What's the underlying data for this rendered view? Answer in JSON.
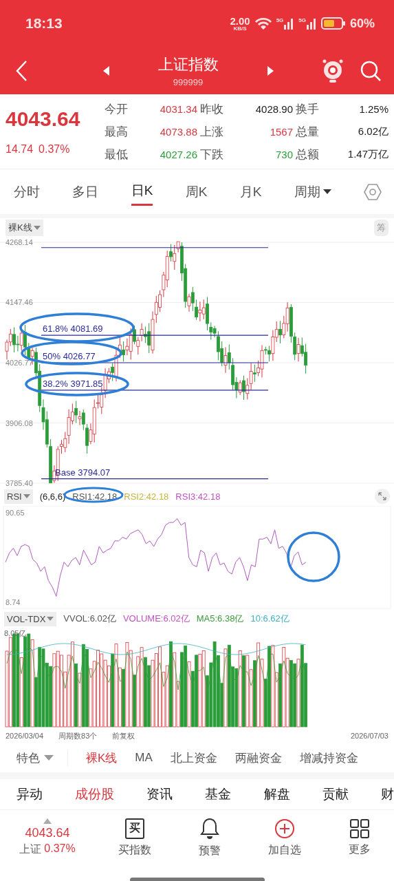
{
  "status_bar": {
    "time": "18:13",
    "net_speed": "2.00",
    "net_unit": "KB/S",
    "signals": [
      "5G",
      "5G"
    ],
    "battery": "60%"
  },
  "nav": {
    "title": "上证指数",
    "code": "999999"
  },
  "quote": {
    "price": "4043.64",
    "change": "14.74",
    "change_pct": "0.37%",
    "color": "#d9363e",
    "stats": [
      {
        "label": "今开",
        "value": "4031.34",
        "color": "#d9363e"
      },
      {
        "label": "昨收",
        "value": "4028.90",
        "color": "#222222"
      },
      {
        "label": "换手",
        "value": "1.25%",
        "color": "#222222"
      },
      {
        "label": "最高",
        "value": "4073.88",
        "color": "#d9363e"
      },
      {
        "label": "上涨",
        "value": "1567",
        "color": "#d9363e"
      },
      {
        "label": "总量",
        "value": "6.02亿",
        "color": "#222222"
      },
      {
        "label": "最低",
        "value": "4027.26",
        "color": "#2a9d3a"
      },
      {
        "label": "下跌",
        "value": "730",
        "color": "#2a9d3a"
      },
      {
        "label": "总额",
        "value": "1.47万亿",
        "color": "#222222"
      }
    ]
  },
  "period_tabs": [
    {
      "label": "分时",
      "selected": false,
      "dropdown": false
    },
    {
      "label": "多日",
      "selected": false,
      "dropdown": false
    },
    {
      "label": "日K",
      "selected": true,
      "dropdown": false
    },
    {
      "label": "周K",
      "selected": false,
      "dropdown": false
    },
    {
      "label": "月K",
      "selected": false,
      "dropdown": false
    },
    {
      "label": "周期",
      "selected": false,
      "dropdown": true
    }
  ],
  "kchart": {
    "mode": "裸K线",
    "side_button": "筹",
    "y_labels": [
      "4268.14",
      "4147.46",
      "4026.77",
      "3906.08",
      "3785.40"
    ],
    "fib_levels": [
      {
        "label": "61.8% 4081.69"
      },
      {
        "label": "50% 4026.77"
      },
      {
        "label": "38.2% 3971.85"
      },
      {
        "label": "Base 3794.07"
      }
    ]
  },
  "rsi": {
    "name": "RSI",
    "params": "(6,6,6)",
    "readings": [
      {
        "label": "RSI1:42.18",
        "color": "#555555"
      },
      {
        "label": "RSI2:42.18",
        "color": "#c8b43c"
      },
      {
        "label": "RSI3:42.18",
        "color": "#c050c0"
      }
    ],
    "y_max": "90.65",
    "y_min": "8.74"
  },
  "vol": {
    "name": "VOL-TDX",
    "readings": [
      {
        "label": "VVOL:6.02亿",
        "color": "#555555"
      },
      {
        "label": "VOLUME:6.02亿",
        "color": "#c050c0"
      },
      {
        "label": "MA5:6.38亿",
        "color": "#3a9a3a"
      },
      {
        "label": "10:6.62亿",
        "color": "#3ab0c0"
      }
    ],
    "y_max": "8.05亿"
  },
  "dates": {
    "start": "2026/03/04",
    "count": "周期数83个",
    "adjust": "前复权",
    "end": "2026/07/03"
  },
  "indicator_tabs": {
    "menu": "特色",
    "items": [
      {
        "label": "裸K线",
        "selected": true
      },
      {
        "label": "MA",
        "selected": false
      },
      {
        "label": "北上资金",
        "selected": false
      },
      {
        "label": "两融资金",
        "selected": false
      },
      {
        "label": "增减持资金",
        "selected": false
      }
    ]
  },
  "content_tabs": [
    {
      "label": "异动",
      "selected": false
    },
    {
      "label": "成份股",
      "selected": true
    },
    {
      "label": "资讯",
      "selected": false
    },
    {
      "label": "基金",
      "selected": false
    },
    {
      "label": "解盘",
      "selected": false
    },
    {
      "label": "贡献",
      "selected": false
    },
    {
      "label": "财",
      "selected": false
    }
  ],
  "bottom_bar": {
    "price": "4043.64",
    "name": "上证",
    "change_pct": "0.37%",
    "color": "#d9363e",
    "actions": [
      {
        "kind": "buy",
        "icon_text": "买",
        "label": "买指数"
      },
      {
        "kind": "bell",
        "label": "预警"
      },
      {
        "kind": "add",
        "label": "加自选"
      },
      {
        "kind": "grid",
        "label": "更多"
      }
    ]
  }
}
